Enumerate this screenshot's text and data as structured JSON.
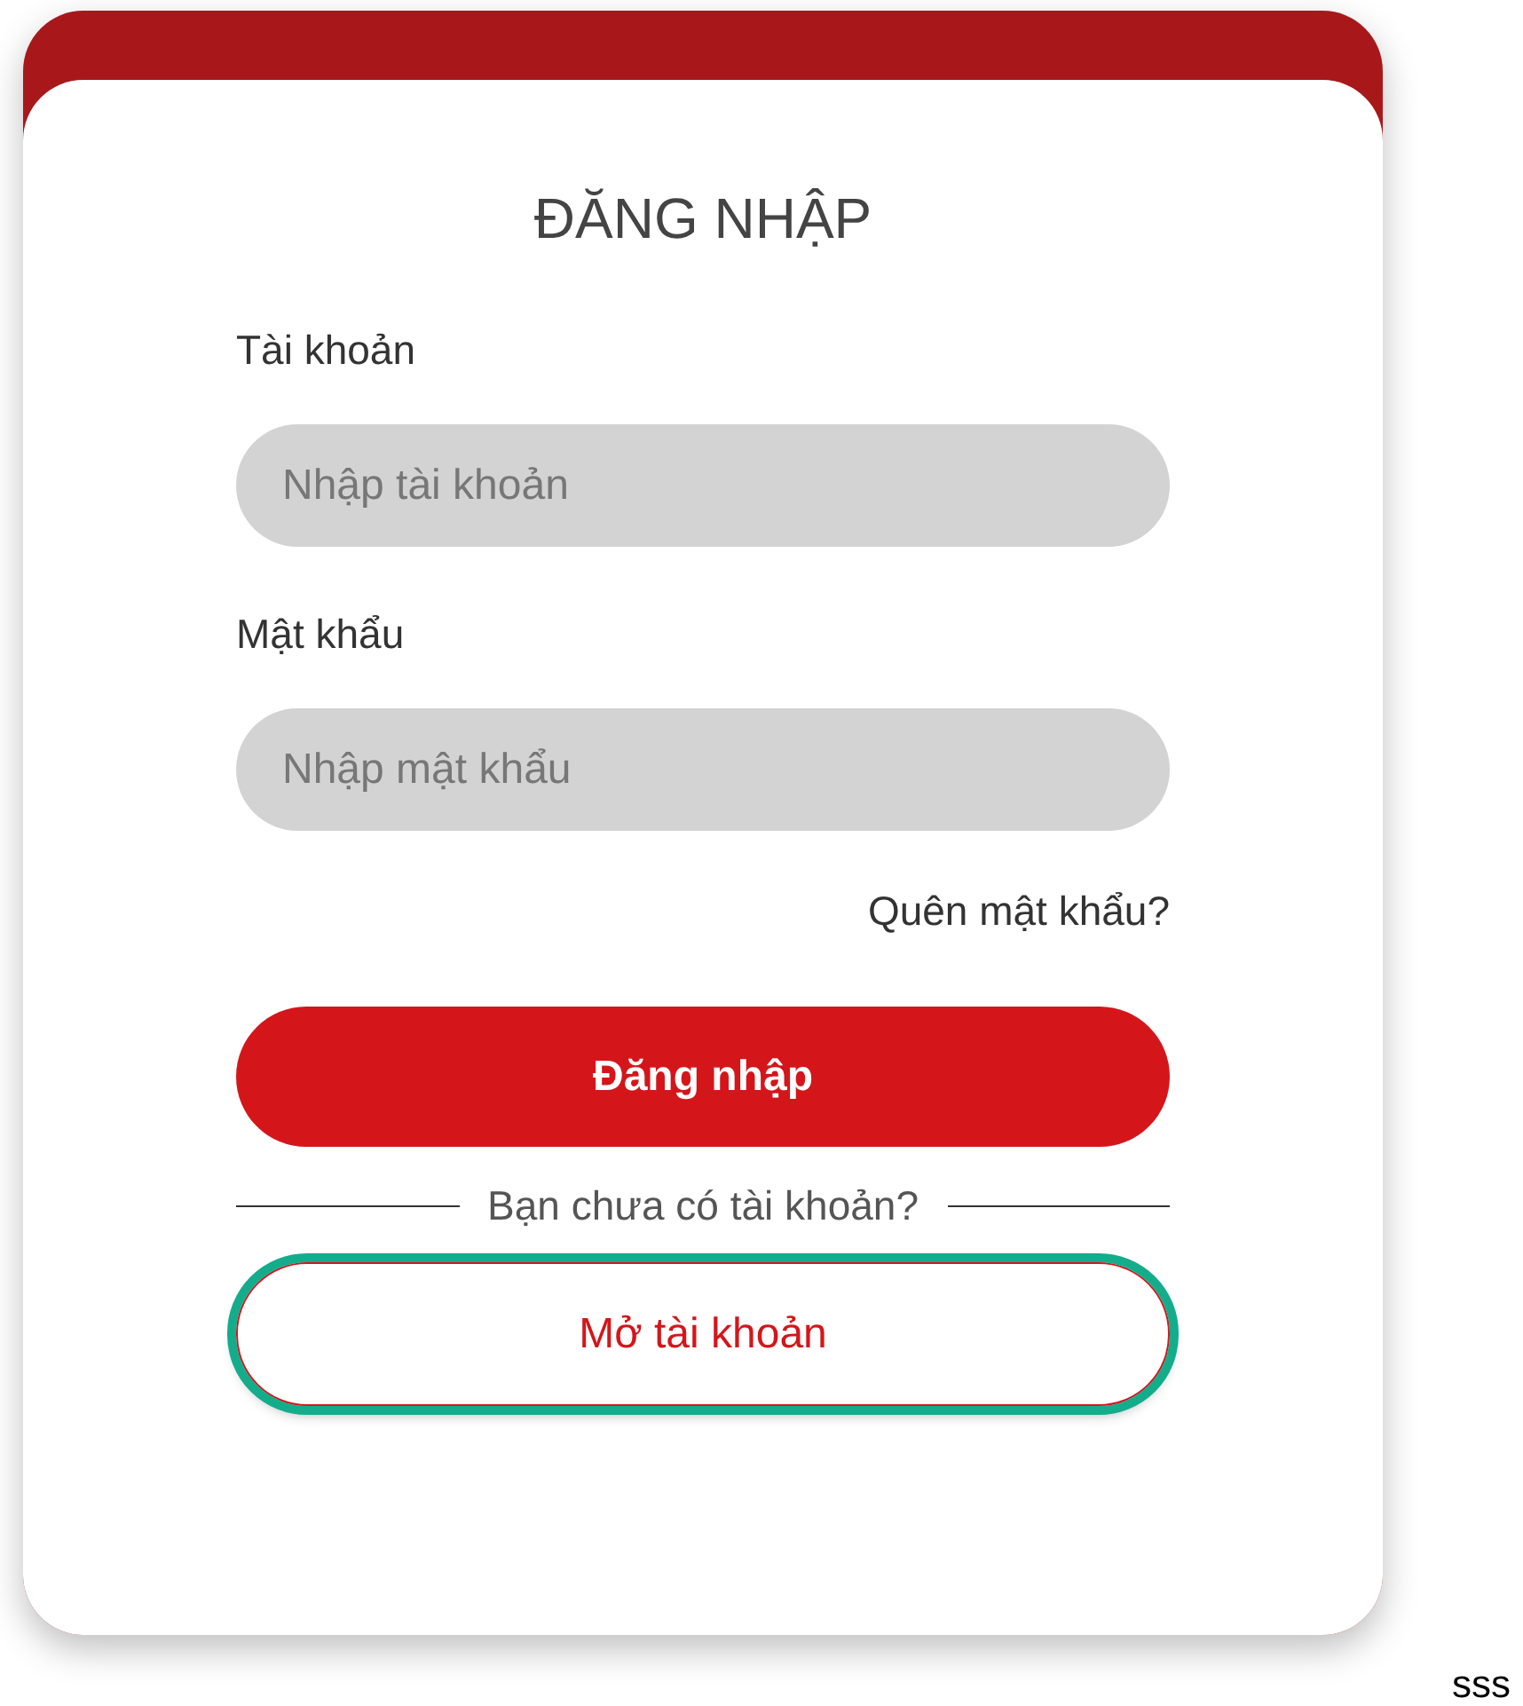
{
  "login_card": {
    "title": "ĐĂNG NHẬP",
    "fields": [
      {
        "label": "Tài khoản",
        "placeholder": "Nhập tài khoản"
      },
      {
        "label": "Mật khẩu",
        "placeholder": "Nhập mật khẩu"
      }
    ],
    "forgot_link": "Quên mật khẩu?",
    "submit_button": "Đăng nhập",
    "divider_text": "Bạn chưa có tài khoản?",
    "register_button": {
      "label": "Mở tài khoản",
      "highlighted": true
    }
  },
  "footer_text": "sss"
}
